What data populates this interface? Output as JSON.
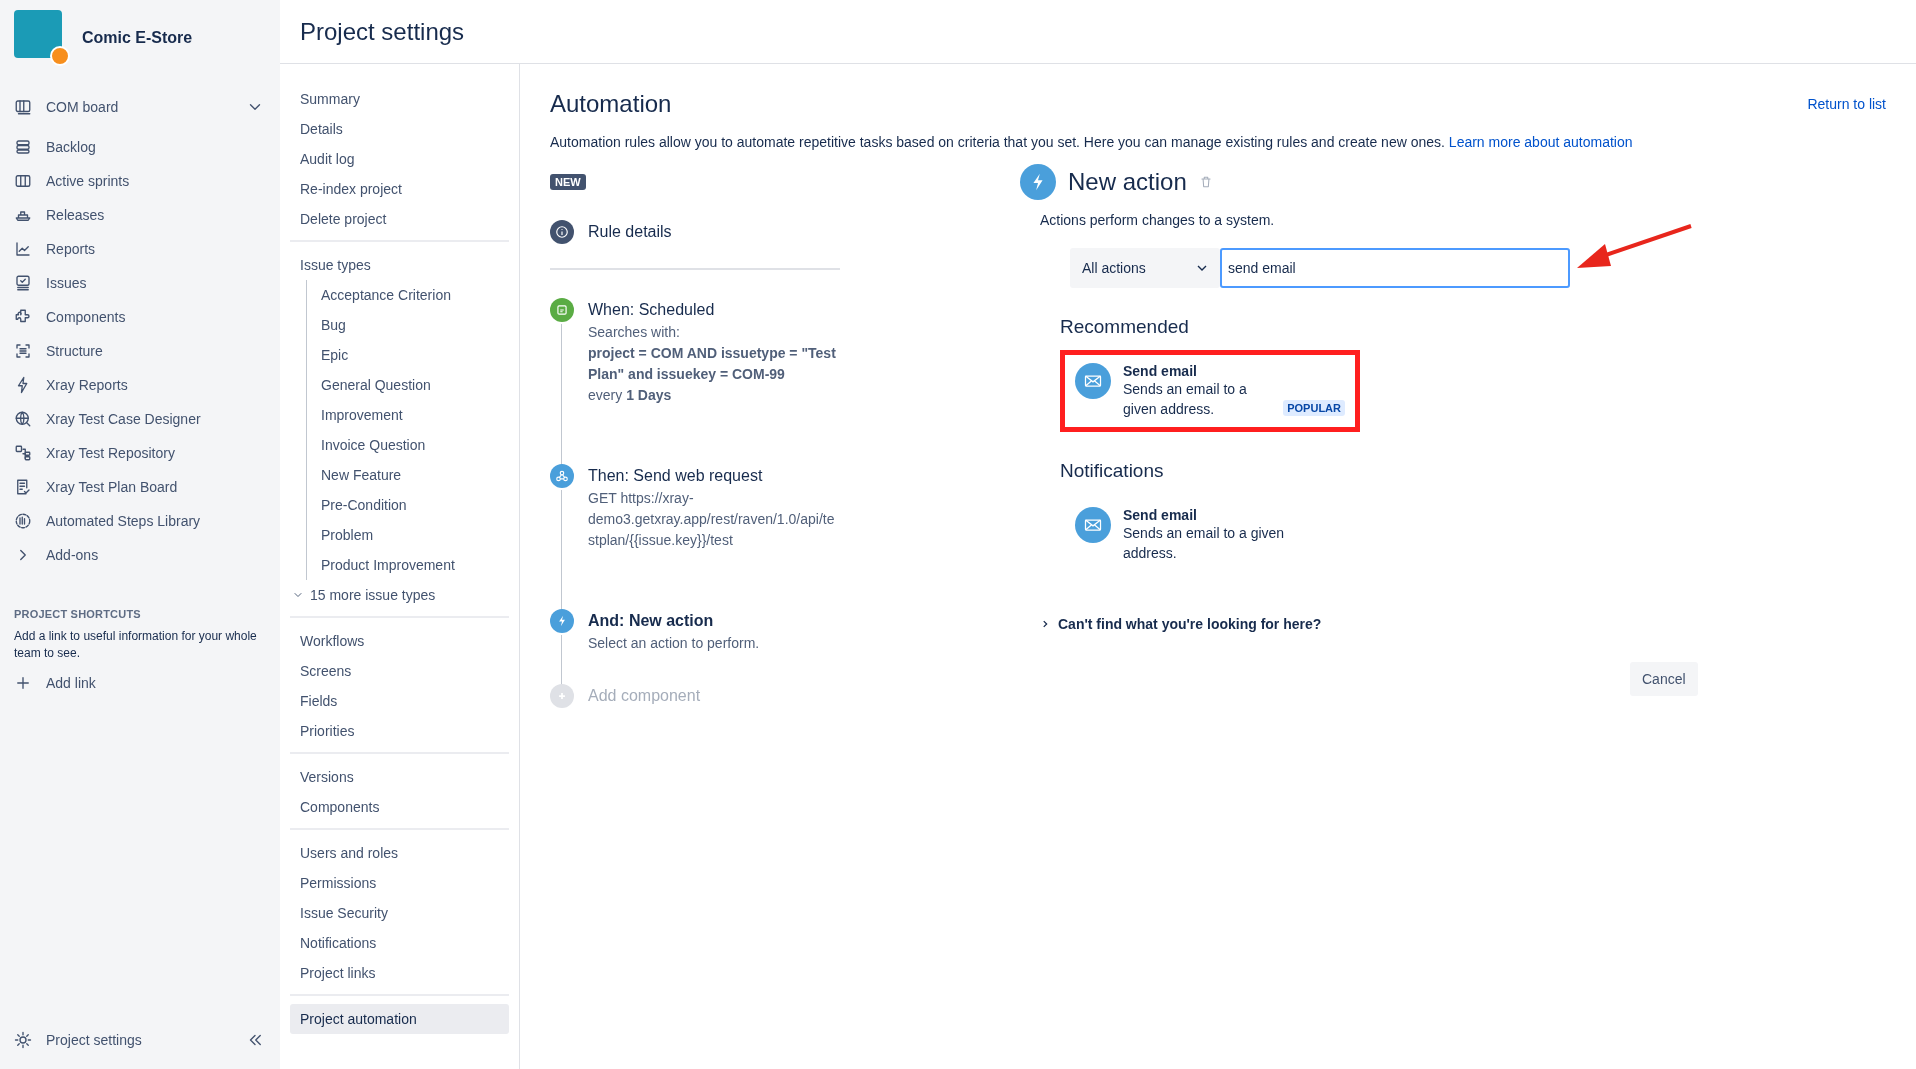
{
  "project": {
    "name": "Comic E-Store"
  },
  "sidebar": {
    "board": {
      "label": "COM board",
      "expanded": false
    },
    "items": [
      {
        "label": "Backlog"
      },
      {
        "label": "Active sprints"
      },
      {
        "label": "Releases"
      },
      {
        "label": "Reports"
      },
      {
        "label": "Issues"
      },
      {
        "label": "Components"
      },
      {
        "label": "Structure"
      },
      {
        "label": "Xray Reports"
      },
      {
        "label": "Xray Test Case Designer"
      },
      {
        "label": "Xray Test Repository"
      },
      {
        "label": "Xray Test Plan Board"
      },
      {
        "label": "Automated Steps Library"
      }
    ],
    "addons": {
      "label": "Add-ons",
      "expanded": false
    },
    "shortcuts": {
      "heading": "PROJECT SHORTCUTS",
      "text": "Add a link to useful information for your whole team to see.",
      "add_link": "Add link"
    },
    "footer": {
      "label": "Project settings"
    }
  },
  "page_title": "Project settings",
  "settings_nav": {
    "groups": [
      [
        {
          "label": "Summary",
          "selected": false
        },
        {
          "label": "Details",
          "selected": false
        },
        {
          "label": "Audit log",
          "selected": false
        },
        {
          "label": "Re-index project",
          "selected": false
        },
        {
          "label": "Delete project",
          "selected": false
        }
      ],
      [
        {
          "label": "Issue types",
          "selected": false,
          "children": [
            {
              "label": "Acceptance Criterion",
              "selected": false
            },
            {
              "label": "Bug",
              "selected": false
            },
            {
              "label": "Epic",
              "selected": false
            },
            {
              "label": "General Question",
              "selected": false
            },
            {
              "label": "Improvement",
              "selected": false
            },
            {
              "label": "Invoice Question",
              "selected": false
            },
            {
              "label": "New Feature",
              "selected": false
            },
            {
              "label": "Pre-Condition",
              "selected": false
            },
            {
              "label": "Problem",
              "selected": false
            },
            {
              "label": "Product Improvement",
              "selected": false
            }
          ],
          "more": "15 more issue types"
        }
      ],
      [
        {
          "label": "Workflows",
          "selected": false
        },
        {
          "label": "Screens",
          "selected": false
        },
        {
          "label": "Fields",
          "selected": false
        },
        {
          "label": "Priorities",
          "selected": false
        }
      ],
      [
        {
          "label": "Versions",
          "selected": false
        },
        {
          "label": "Components",
          "selected": false
        }
      ],
      [
        {
          "label": "Users and roles",
          "selected": false
        },
        {
          "label": "Permissions",
          "selected": false
        },
        {
          "label": "Issue Security",
          "selected": false
        },
        {
          "label": "Notifications",
          "selected": false
        },
        {
          "label": "Project links",
          "selected": false
        }
      ],
      [
        {
          "label": "Project automation",
          "selected": true
        }
      ]
    ]
  },
  "automation": {
    "title": "Automation",
    "return_link": "Return to list",
    "description": "Automation rules allow you to automate repetitive tasks based on criteria that you set. Here you can manage existing rules and create new ones.",
    "learn_more": "Learn more about automation",
    "badge": "NEW",
    "steps": [
      {
        "kind": "details",
        "title": "Rule details"
      },
      {
        "kind": "trigger",
        "title": "When: Scheduled",
        "lines": [
          "Searches with:",
          "**project = COM AND issuetype = \"Test Plan\" and issuekey = COM-99**",
          "every **1 Days**"
        ]
      },
      {
        "kind": "action",
        "title": "Then: Send web request",
        "lines": [
          "GET https://xray-demo3.getxray.app/rest/raven/1.0/api/testplan/{{issue.key}}/test"
        ]
      },
      {
        "kind": "new",
        "title": "And: New action",
        "lines": [
          "Select an action to perform."
        ]
      },
      {
        "kind": "add",
        "title": "Add component"
      }
    ]
  },
  "panel": {
    "title": "New action",
    "subtitle": "Actions perform changes to a system.",
    "filter": "All actions",
    "search": {
      "value": "send email",
      "annotated": true
    },
    "sections": [
      {
        "heading": "Recommended",
        "items": [
          {
            "title": "Send email",
            "description": "Sends an email to a given address.",
            "badge": "POPULAR",
            "highlighted": true
          }
        ]
      },
      {
        "heading": "Notifications",
        "items": [
          {
            "title": "Send email",
            "description": "Sends an email to a given address.",
            "highlighted": false
          }
        ]
      }
    ],
    "help": "Can't find what you're looking for here?",
    "cancel": "Cancel"
  }
}
